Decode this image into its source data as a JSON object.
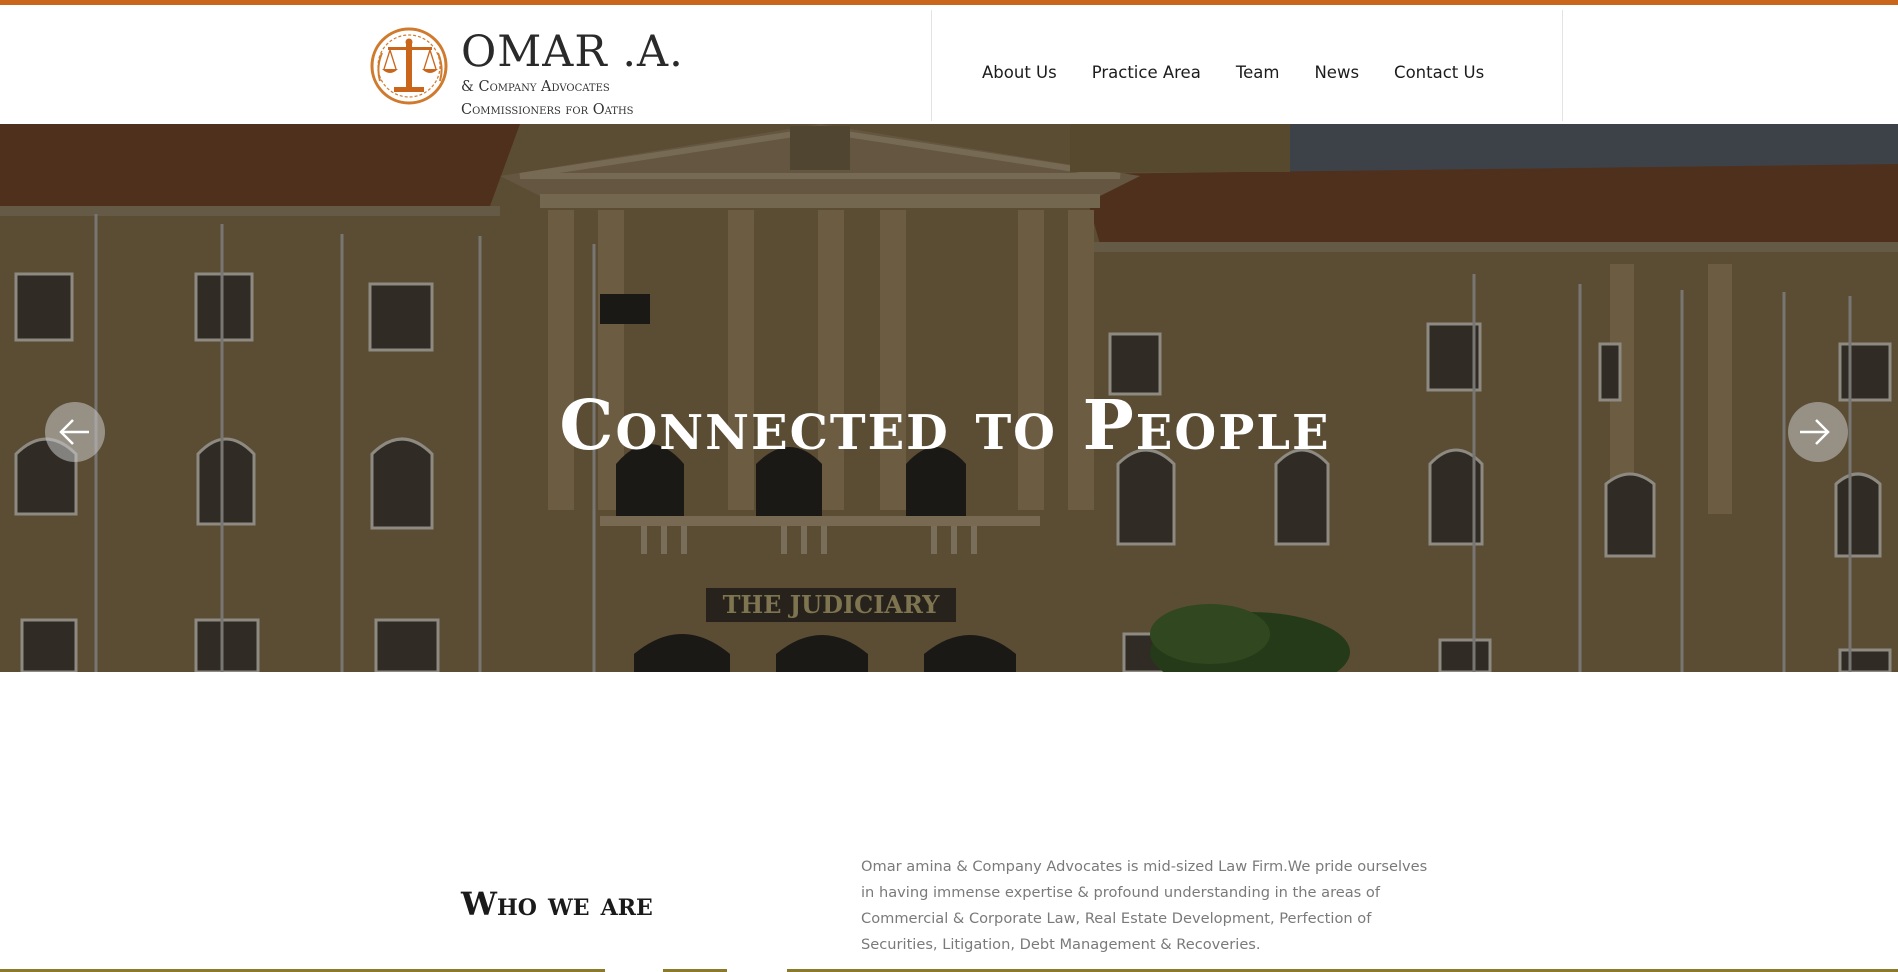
{
  "header": {
    "logo": {
      "name": "OMAR .A.",
      "line2": "& Company Advocates",
      "line3": "Commissioners for Oaths"
    },
    "nav": [
      {
        "label": "About Us"
      },
      {
        "label": "Practice Area"
      },
      {
        "label": "Team"
      },
      {
        "label": "News"
      },
      {
        "label": "Contact Us"
      }
    ]
  },
  "hero": {
    "title": "Connected to People",
    "building_sign": "THE JUDICIARY",
    "prev_icon": "arrow-left-icon",
    "next_icon": "arrow-right-icon"
  },
  "about": {
    "title": "Who we are",
    "text": "Omar amina & Company Advocates is mid-sized Law Firm.We pride ourselves in having immense expertise & profound understanding in the areas of Commercial & Corporate Law, Real Estate Development, Perfection of Securities, Litigation, Debt Management & Recoveries."
  },
  "colors": {
    "accent": "#c9661c",
    "nav_text": "#1c1c1c",
    "body_text": "#7a7a7a"
  }
}
